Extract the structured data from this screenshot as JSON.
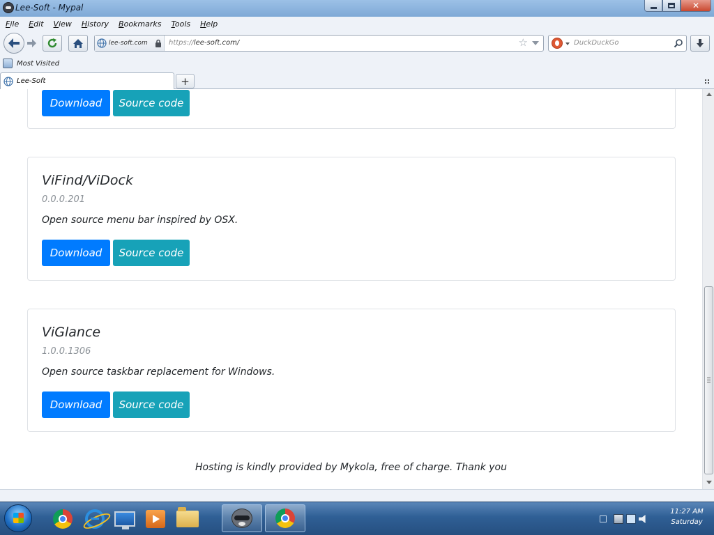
{
  "window": {
    "title": "Lee-Soft - Mypal"
  },
  "menu": [
    {
      "label": "File",
      "key": "F",
      "rest": "ile"
    },
    {
      "label": "Edit",
      "key": "E",
      "rest": "dit"
    },
    {
      "label": "View",
      "key": "V",
      "rest": "iew"
    },
    {
      "label": "History",
      "key": "H",
      "rest": "istory"
    },
    {
      "label": "Bookmarks",
      "key": "B",
      "rest": "ookmarks"
    },
    {
      "label": "Tools",
      "key": "T",
      "rest": "ools"
    },
    {
      "label": "Help",
      "key": "H",
      "rest": "elp"
    }
  ],
  "urlbar": {
    "identity_host": "lee-soft.com",
    "protocol": "https://",
    "address": "lee-soft.com/"
  },
  "search": {
    "placeholder": "DuckDuckGo"
  },
  "bookmarks": {
    "most_visited": "Most Visited"
  },
  "tab": {
    "label": "Lee-Soft"
  },
  "cards": [
    {
      "title": "",
      "version": "",
      "description": "",
      "download_label": "Download",
      "source_label": "Source code"
    },
    {
      "title": "ViFind/ViDock",
      "version": "0.0.0.201",
      "description": "Open source menu bar inspired by OSX.",
      "download_label": "Download",
      "source_label": "Source code"
    },
    {
      "title": "ViGlance",
      "version": "1.0.0.1306",
      "description": "Open source taskbar replacement for Windows.",
      "download_label": "Download",
      "source_label": "Source code"
    }
  ],
  "footer": {
    "text": "Hosting is kindly provided by Mykola, free of charge. Thank you"
  },
  "taskbar": {
    "pinned": [
      "chrome-icon",
      "internet-explorer-icon",
      "monitor-icon",
      "media-player-icon",
      "folder-icon"
    ],
    "running": [
      "mypal-raccoon-icon",
      "chrome-icon"
    ]
  },
  "clock": {
    "time": "11:27 AM",
    "day": "Saturday"
  },
  "colors": {
    "download_button": "#007bff",
    "source_button": "#17a2b8",
    "taskbar": "#2f5f95"
  }
}
